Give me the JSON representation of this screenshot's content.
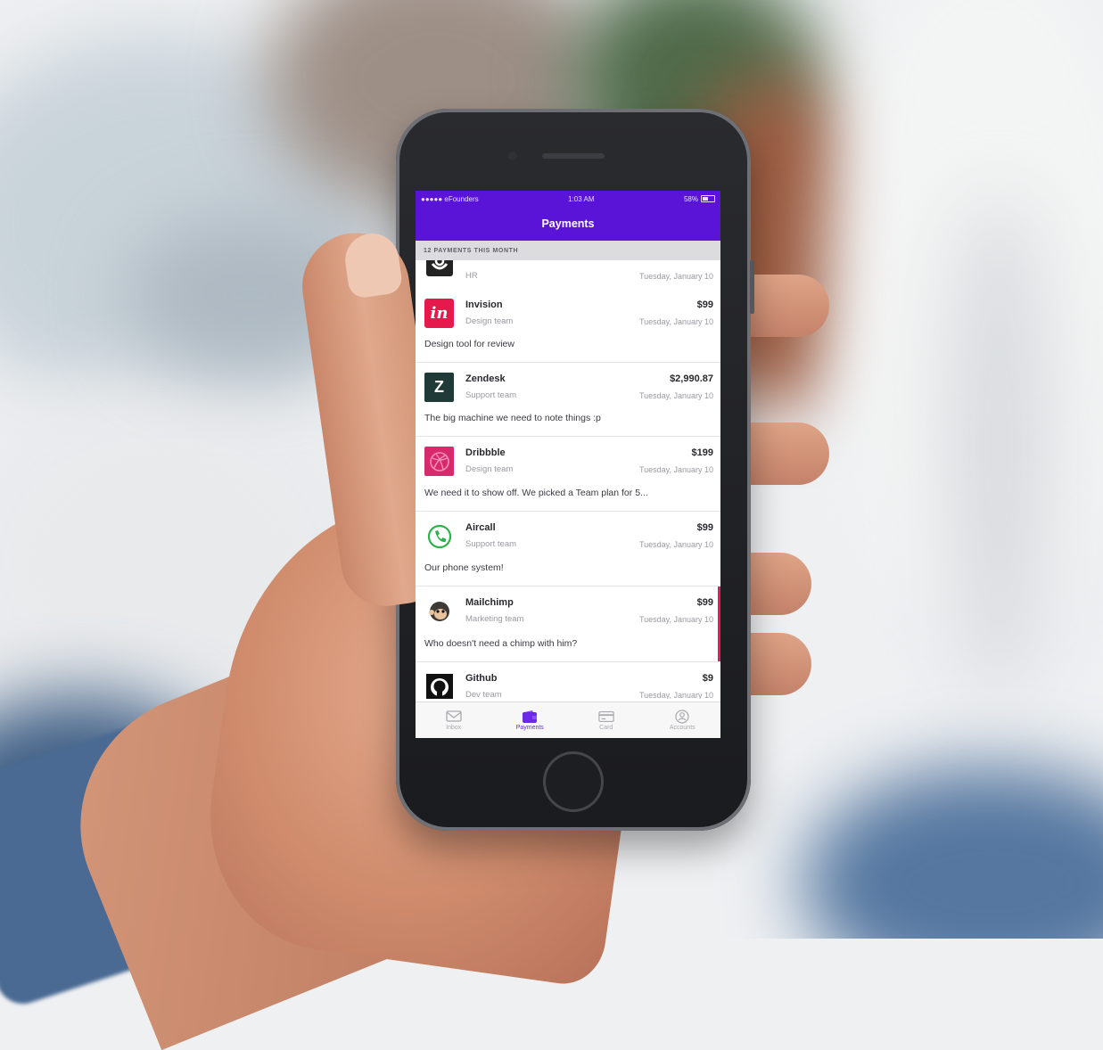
{
  "status_bar": {
    "carrier": "●●●●● eFounders",
    "time": "1:03 AM",
    "battery": "58%"
  },
  "nav": {
    "title": "Payments"
  },
  "section": {
    "header": "12 PAYMENTS THIS MONTH"
  },
  "payments": [
    {
      "name": "",
      "team": "HR",
      "amount": "",
      "date": "Tuesday, January 10",
      "note": "",
      "logo_icon": "hr-app-icon",
      "color": "#222222"
    },
    {
      "name": "Invision",
      "team": "Design team",
      "amount": "$99",
      "date": "Tuesday, January 10",
      "note": "Design tool for review",
      "logo_icon": "invision-icon",
      "logo_text": "in",
      "color": "#e6194d"
    },
    {
      "name": "Zendesk",
      "team": "Support team",
      "amount": "$2,990.87",
      "date": "Tuesday, January 10",
      "note": "The big machine we need to note things :p",
      "logo_icon": "zendesk-icon",
      "logo_text": "Z",
      "color": "#1f3a37"
    },
    {
      "name": "Dribbble",
      "team": "Design team",
      "amount": "$199",
      "date": "Tuesday, January 10",
      "note": "We need it to show off. We picked a Team plan for 5...",
      "logo_icon": "dribbble-icon",
      "color": "#d9296d"
    },
    {
      "name": "Aircall",
      "team": "Support team",
      "amount": "$99",
      "date": "Tuesday, January 10",
      "note": "Our phone system!",
      "logo_icon": "aircall-phone-icon",
      "color": "#2bb34a"
    },
    {
      "name": "Mailchimp",
      "team": "Marketing team",
      "amount": "$99",
      "date": "Tuesday, January 10",
      "note": "Who doesn't need a chimp with him?",
      "logo_icon": "mailchimp-icon",
      "color": "#3d3a35"
    },
    {
      "name": "Github",
      "team": "Dev team",
      "amount": "$9",
      "date": "Tuesday, January 10",
      "note": "",
      "logo_icon": "github-icon",
      "color": "#111111"
    }
  ],
  "tabs": [
    {
      "label": "Inbox",
      "icon": "envelope-icon",
      "active": false
    },
    {
      "label": "Payments",
      "icon": "wallet-icon",
      "active": true
    },
    {
      "label": "Card",
      "icon": "credit-card-icon",
      "active": false
    },
    {
      "label": "Accounts",
      "icon": "user-icon",
      "active": false
    }
  ],
  "colors": {
    "brand": "#5a14d8",
    "accent": "#e31b56",
    "tab_active": "#6d29e8"
  }
}
